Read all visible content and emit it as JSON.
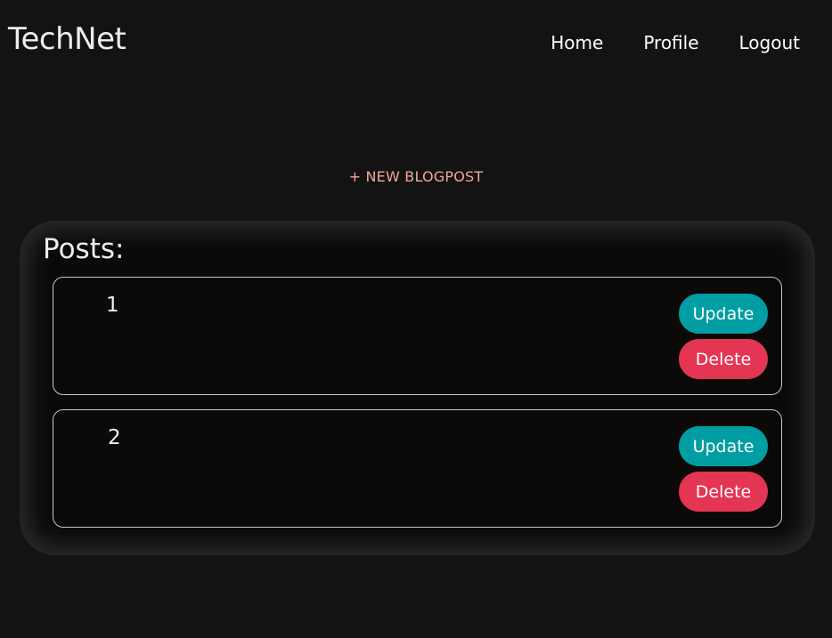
{
  "header": {
    "brand": "TechNet",
    "nav": [
      "Home",
      "Profile",
      "Logout"
    ]
  },
  "actions": {
    "new_blogpost": "+ NEW BLOGPOST"
  },
  "posts": {
    "title": "Posts:",
    "items": [
      {
        "id": "1",
        "update_label": "Update",
        "delete_label": "Delete"
      },
      {
        "id": "2",
        "update_label": "Update",
        "delete_label": "Delete"
      }
    ]
  },
  "colors": {
    "background": "#131313",
    "update_button": "#009ea3",
    "delete_button": "#e43552",
    "new_blogpost_link": "#f2a795"
  }
}
